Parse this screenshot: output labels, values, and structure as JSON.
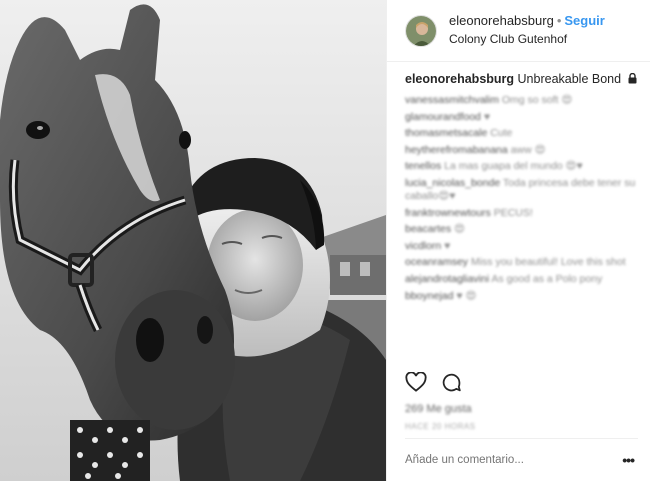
{
  "header": {
    "username": "eleonorehabsburg",
    "separator": "•",
    "follow_label": "Seguir",
    "location": "Colony Club Gutenhof"
  },
  "caption": {
    "username": "eleonorehabsburg",
    "text": "Unbreakable Bond"
  },
  "comments": [
    {
      "user": "vanessasmitchvalim",
      "text": "Omg so soft 😍"
    },
    {
      "user": "glamourandfood",
      "text": "♥"
    },
    {
      "user": "thomasmetsacale",
      "text": "Cute"
    },
    {
      "user": "heytherefromabanana",
      "text": "aww 😍"
    },
    {
      "user": "tenellos",
      "text": "La mas guapa del mundo 😍♥"
    },
    {
      "user": "lucia_nicolas_bonde",
      "text": "Toda princesa debe tener su caballo😍♥"
    },
    {
      "user": "franktrownewtours",
      "text": "PECUS!"
    },
    {
      "user": "beacartes",
      "text": "😍"
    },
    {
      "user": "vicdlorn",
      "text": "♥"
    },
    {
      "user": "oceanramsey",
      "text": "Miss you beautiful! Love this shot"
    },
    {
      "user": "alejandrotagliavini",
      "text": "As good as a Polo pony"
    },
    {
      "user": "bboynejad",
      "text": "♥ 😍"
    }
  ],
  "likes_text": "269 Me gusta",
  "time_text": "HACE 20 HORAS",
  "add_comment_placeholder": "Añade un comentario...",
  "more_label": "•••",
  "icons": {
    "like": "heart-icon",
    "comment": "comment-icon",
    "lock": "lock-icon"
  },
  "colors": {
    "follow": "#3897f0",
    "text": "#262626",
    "muted": "#999999",
    "divider": "#efefef"
  }
}
